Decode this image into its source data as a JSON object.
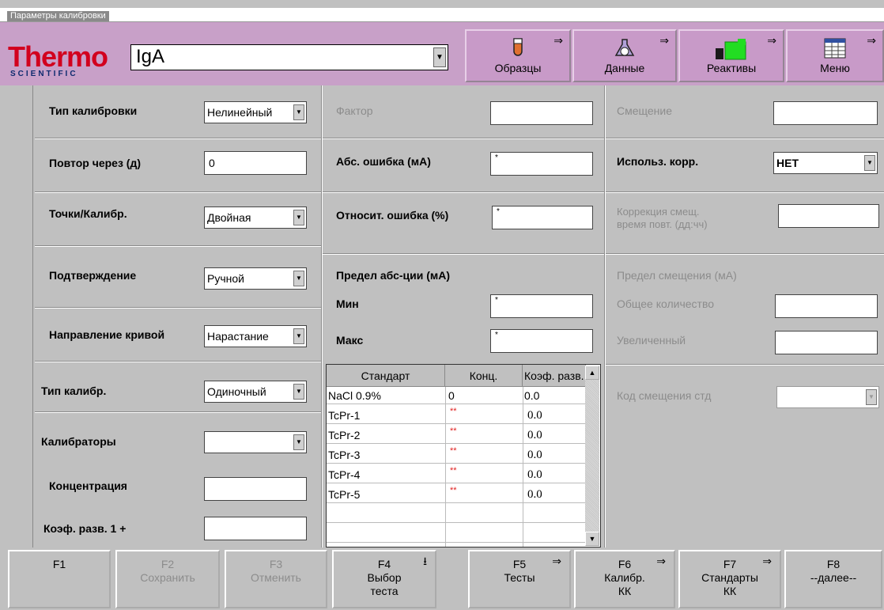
{
  "window": {
    "title": "Параметры калибровки"
  },
  "header": {
    "logo_main": "Thermo",
    "logo_sub": "SCIENTIFIC",
    "test_value": "IgA",
    "nav": [
      {
        "label": "Образцы",
        "icon": "test-tube-icon"
      },
      {
        "label": "Данные",
        "icon": "data-flask-icon"
      },
      {
        "label": "Реактивы",
        "icon": "reagents-icon"
      },
      {
        "label": "Меню",
        "icon": "menu-grid-icon"
      }
    ],
    "arrow": "⇒"
  },
  "col1": {
    "cal_type": {
      "label": "Тип калибровки",
      "value": "Нелинейный"
    },
    "repeat": {
      "label": "Повтор через (д)",
      "value": "0"
    },
    "points": {
      "label": "Точки/Калибр.",
      "value": "Двойная"
    },
    "confirm": {
      "label": "Подтверждение",
      "value": "Ручной"
    },
    "direction": {
      "label": "Направление кривой",
      "value": "Нарастание"
    },
    "cal_kind": {
      "label": "Тип калибр.",
      "value": "Одиночный"
    },
    "calibrators": {
      "label": "Калибраторы",
      "value": ""
    },
    "concentration": {
      "label": "Концентрация",
      "value": ""
    },
    "dilution": {
      "label": "Коэф. разв. 1 +",
      "value": ""
    }
  },
  "col2": {
    "factor": {
      "label": "Фактор",
      "value": ""
    },
    "abs_err": {
      "label": "Абс. ошибка (мА)",
      "value": "*"
    },
    "rel_err": {
      "label": "Относит. ошибка (%)",
      "value": "*"
    },
    "abs_limit": {
      "label": "Предел абс-ции (мА)"
    },
    "min": {
      "label": "Мин",
      "value": "*"
    },
    "max": {
      "label": "Макс",
      "value": "*"
    },
    "table": {
      "headers": [
        "Стандарт",
        "Конц.",
        "Коэф. разв."
      ],
      "rows": [
        [
          "NaCl 0.9%",
          "0",
          "0.0"
        ],
        [
          "TcPr-1",
          "**",
          "0.0"
        ],
        [
          "TcPr-2",
          "**",
          "0.0"
        ],
        [
          "TcPr-3",
          "**",
          "0.0"
        ],
        [
          "TcPr-4",
          "**",
          "0.0"
        ],
        [
          "TcPr-5",
          "**",
          "0.0"
        ],
        [
          "",
          "",
          ""
        ],
        [
          "",
          "",
          ""
        ]
      ]
    }
  },
  "col3": {
    "offset": {
      "label": "Смещение",
      "value": ""
    },
    "use_corr": {
      "label": "Использ. корр.",
      "value": "НЕТ"
    },
    "offset_corr": {
      "label1": "Коррекция смещ.",
      "label2": "время повт. (дд:чч)",
      "value": ""
    },
    "offset_limit": {
      "label": "Предел смещения (мА)"
    },
    "total": {
      "label": "Общее количество",
      "value": ""
    },
    "increased": {
      "label": "Увеличенный",
      "value": ""
    },
    "offset_code": {
      "label": "Код смещения стд",
      "value": ""
    }
  },
  "fkeys": [
    {
      "key": "F1",
      "label": "",
      "disabled": false
    },
    {
      "key": "F2",
      "label": "Сохранить",
      "disabled": true
    },
    {
      "key": "F3",
      "label": "Отменить",
      "disabled": true
    },
    {
      "key": "F4",
      "label": "Выбор теста",
      "disabled": false
    },
    {
      "key": "F5",
      "label": "Тесты",
      "disabled": false
    },
    {
      "key": "F6",
      "label": "Калибр. КК",
      "disabled": false
    },
    {
      "key": "F7",
      "label": "Стандарты КК",
      "disabled": false
    },
    {
      "key": "F8",
      "label": "--далее--",
      "disabled": false
    }
  ],
  "colors": {
    "header": "#c8a0c8",
    "brand_red": "#d2001e",
    "brand_blue": "#0d2a6e",
    "panel": "#c0c0c0",
    "star": "#e02020"
  }
}
